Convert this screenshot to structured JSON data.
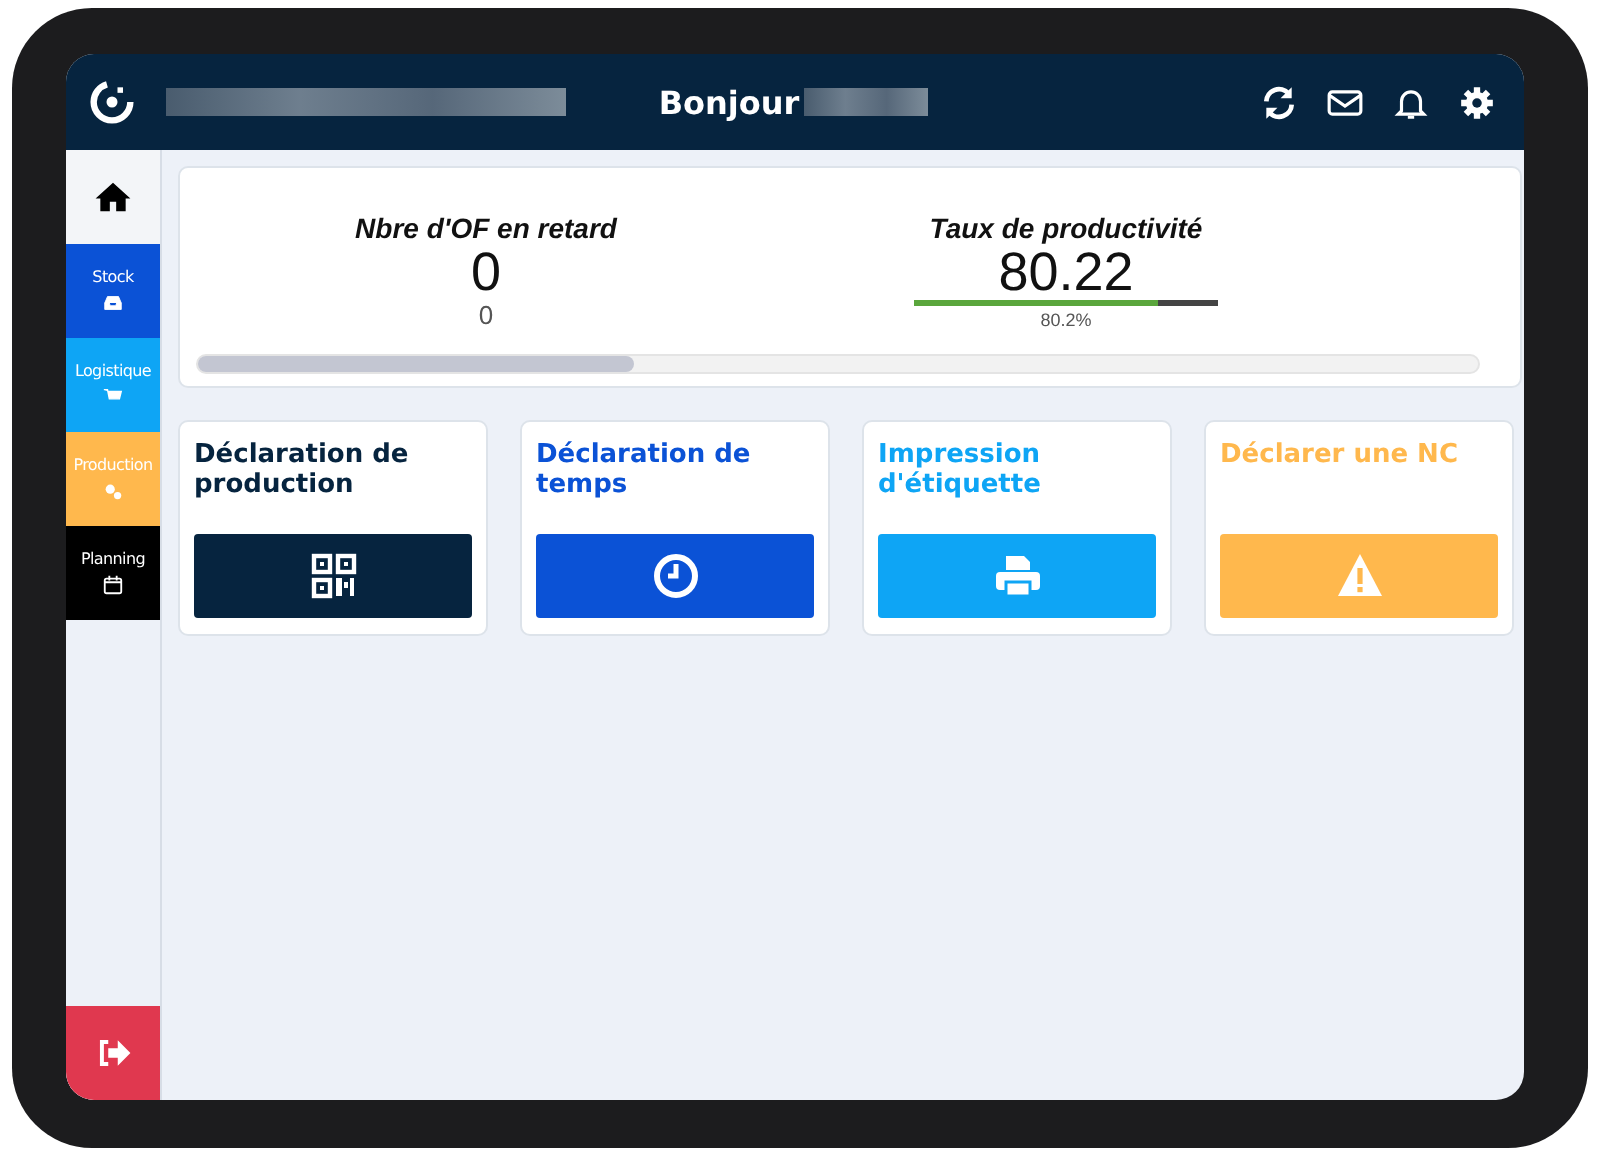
{
  "header": {
    "greeting": "Bonjour"
  },
  "sidebar": {
    "items": [
      {
        "label": "Stock",
        "color": "#0b52d6"
      },
      {
        "label": "Logistique",
        "color": "#0ea5f5"
      },
      {
        "label": "Production",
        "color": "#ffb84d"
      },
      {
        "label": "Planning",
        "color": "#000000"
      }
    ]
  },
  "kpis": [
    {
      "kind": "count",
      "title": "Nbre d'OF en retard",
      "value": "0",
      "sub": "0"
    },
    {
      "kind": "gauge",
      "title": "Taux de productivité",
      "value": "80.22",
      "level": 0.802,
      "sub": "80.2%"
    }
  ],
  "tiles": [
    {
      "title": "Déclaration de production",
      "color": "#06243f"
    },
    {
      "title": "Déclaration de temps",
      "color": "#0b52d6"
    },
    {
      "title": "Impression d'étiquette",
      "color": "#0ea5f5"
    },
    {
      "title": "Déclarer une NC",
      "color": "#ffb84d"
    }
  ]
}
